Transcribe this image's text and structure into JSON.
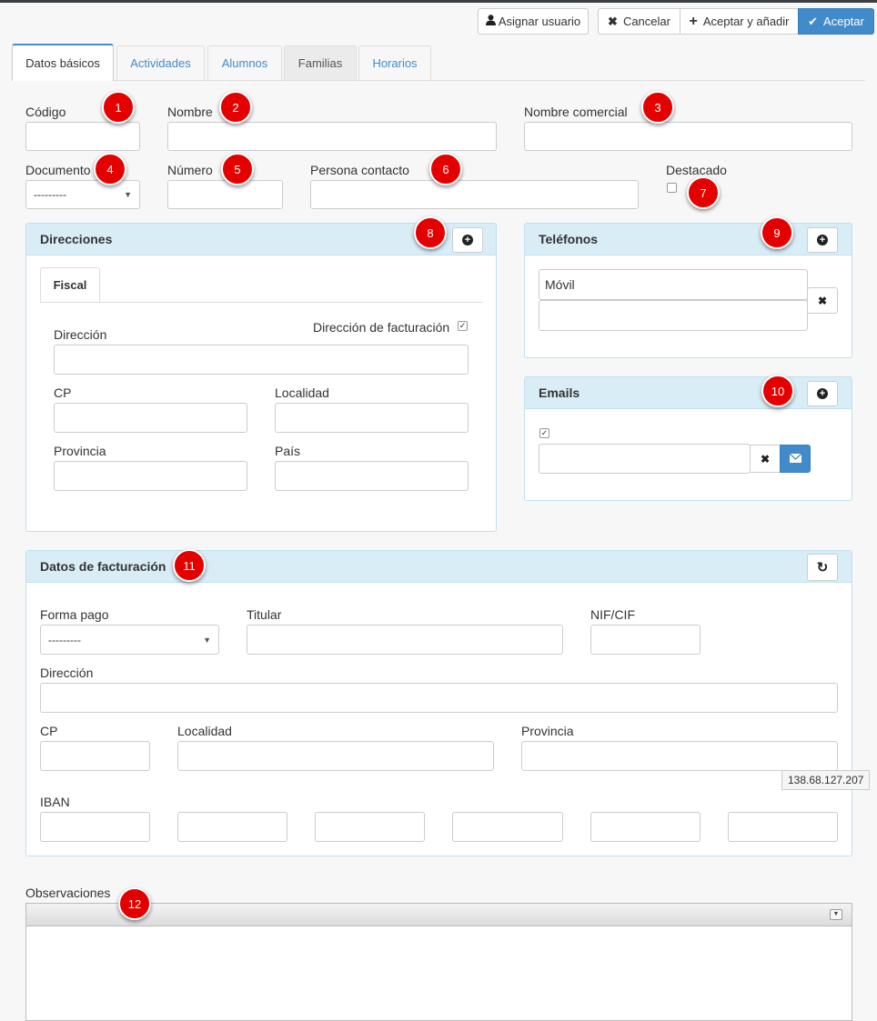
{
  "toolbar": {
    "assign_user": "Asignar usuario",
    "cancel": "Cancelar",
    "accept_add": "Aceptar y añadir",
    "accept": "Aceptar"
  },
  "tabs": [
    {
      "label": "Datos básicos"
    },
    {
      "label": "Actividades"
    },
    {
      "label": "Alumnos"
    },
    {
      "label": "Familias"
    },
    {
      "label": "Horarios"
    }
  ],
  "form": {
    "codigo": "Código",
    "nombre": "Nombre",
    "nombre_comercial": "Nombre comercial",
    "documento": "Documento",
    "documento_value": "---------",
    "numero": "Número",
    "persona_contacto": "Persona contacto",
    "destacado": "Destacado"
  },
  "direcciones": {
    "title": "Direcciones",
    "tab": "Fiscal",
    "facturacion": "Dirección de facturación",
    "direccion": "Dirección",
    "cp": "CP",
    "localidad": "Localidad",
    "provincia": "Provincia",
    "pais": "País"
  },
  "telefonos": {
    "title": "Teléfonos",
    "movil": "Móvil"
  },
  "emails": {
    "title": "Emails"
  },
  "facturacion": {
    "title": "Datos de facturación",
    "forma_pago": "Forma pago",
    "forma_pago_value": "---------",
    "titular": "Titular",
    "nif": "NIF/CIF",
    "direccion": "Dirección",
    "cp": "CP",
    "localidad": "Localidad",
    "provincia": "Provincia",
    "iban": "IBAN"
  },
  "tooltip_ip": "138.68.127.207",
  "observaciones": "Observaciones",
  "badges": [
    "1",
    "2",
    "3",
    "4",
    "5",
    "6",
    "7",
    "8",
    "9",
    "10",
    "11",
    "12"
  ],
  "colors": {
    "badge": "#e50000",
    "primary": "#428bca",
    "panel_head": "#d9edf7"
  }
}
